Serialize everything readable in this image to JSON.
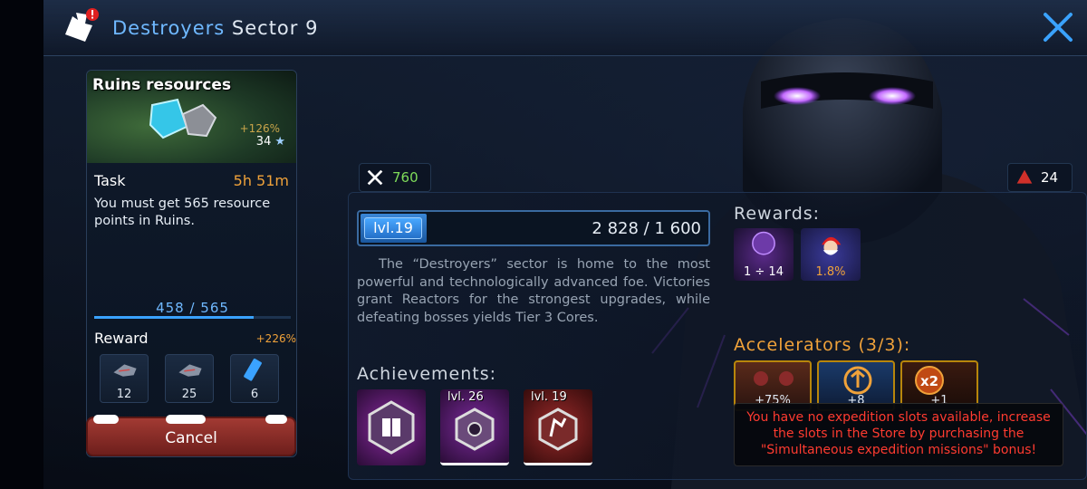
{
  "header": {
    "title_part1": "Destroyers",
    "title_part2": "Sector 9"
  },
  "left_card": {
    "banner_title": "Ruins resources",
    "bonus_pct": "+126%",
    "star_count": "34",
    "task_label": "Task",
    "task_time": "5h 51m",
    "task_desc": "You must get 565 resource points in Ruins.",
    "progress_text": "458 / 565",
    "progress_fraction": 0.81,
    "reward_label": "Reward",
    "reward_pct": "+226%",
    "reward_items": [
      {
        "icon": "ship-icon",
        "count": "12"
      },
      {
        "icon": "ship-icon",
        "count": "25"
      },
      {
        "icon": "blueprint-card-icon",
        "count": "6"
      }
    ],
    "cancel_label": "Cancel"
  },
  "badges": {
    "power": "760",
    "reactors": "24"
  },
  "level": {
    "tag": "lvl.19",
    "value": "2 828 / 1 600",
    "fill_fraction": 0.19
  },
  "description": "The “Destroyers” sector is home to the most powerful and technologically advanced foe. Victories grant Reactors for the strongest upgrades, while defeating bosses yields Tier 3 Cores.",
  "rewards": {
    "title": "Rewards:",
    "items": [
      {
        "icon": "core-icon",
        "label": "1 ÷ 14"
      },
      {
        "icon": "santa-icon",
        "label": "1.8%"
      }
    ]
  },
  "accelerators": {
    "title": "Accelerators (3/3):",
    "items": [
      {
        "icon": "army-icon",
        "label": "+75%"
      },
      {
        "icon": "upgrade-icon",
        "label": "+8"
      },
      {
        "icon": "x2-icon",
        "label": "+1"
      }
    ]
  },
  "tooltip": "You have no expedition slots available, increase the slots in the Store by purchasing the \"Simultaneous expedition missions\" bonus!",
  "achievements": {
    "title": "Achievements:",
    "items": [
      {
        "icon": "book-badge-icon",
        "level": ""
      },
      {
        "icon": "nut-badge-icon",
        "level": "lvl. 26"
      },
      {
        "icon": "rune-badge-icon",
        "level": "lvl. 19"
      }
    ]
  },
  "colors": {
    "accent_blue": "#6fb8ff",
    "accent_orange": "#f0a23a",
    "power_green": "#7fdc5a",
    "warning_red": "#ff3b30"
  }
}
